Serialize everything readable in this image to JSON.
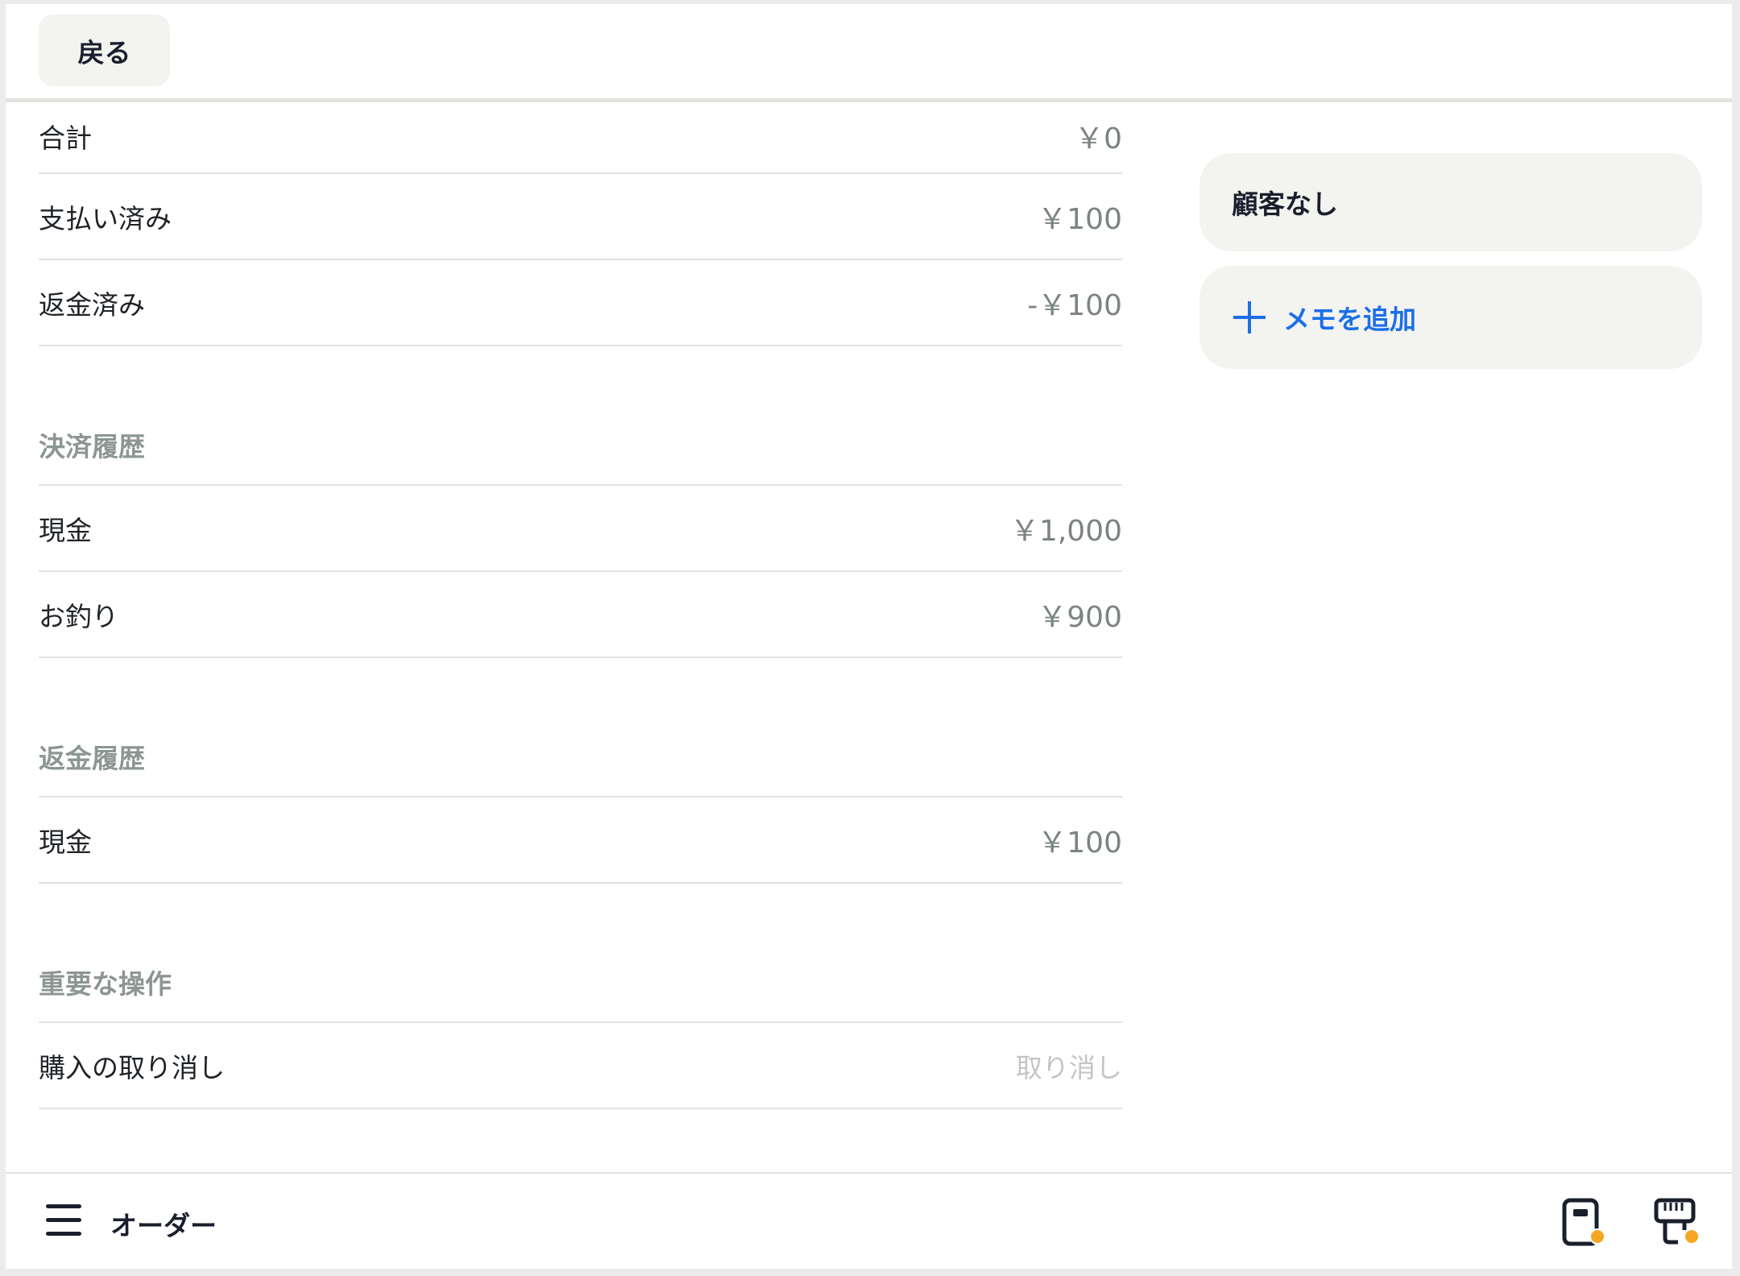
{
  "header": {
    "back_label": "戻る"
  },
  "summary": {
    "rows": [
      {
        "label": "合計",
        "value": "￥0"
      },
      {
        "label": "支払い済み",
        "value": "￥100"
      },
      {
        "label": "返金済み",
        "value": "-￥100"
      }
    ]
  },
  "payment_history": {
    "title": "決済履歴",
    "rows": [
      {
        "label": "現金",
        "value": "￥1,000"
      },
      {
        "label": "お釣り",
        "value": "￥900"
      }
    ]
  },
  "refund_history": {
    "title": "返金履歴",
    "rows": [
      {
        "label": "現金",
        "value": "￥100"
      }
    ]
  },
  "critical_actions": {
    "title": "重要な操作",
    "rows": [
      {
        "label": "購入の取り消し",
        "value": "取り消し"
      }
    ]
  },
  "sidebar": {
    "customer_label": "顧客なし",
    "add_memo_label": "メモを追加"
  },
  "footer": {
    "title": "オーダー",
    "icons": [
      "menu-icon",
      "card-terminal-icon",
      "receipt-printer-icon"
    ],
    "badge_color": "#f5a623"
  },
  "colors": {
    "accent": "#1a6fe8",
    "text": "#1a1f2c",
    "muted": "#7c8482",
    "card_bg": "#f3f3f0"
  }
}
